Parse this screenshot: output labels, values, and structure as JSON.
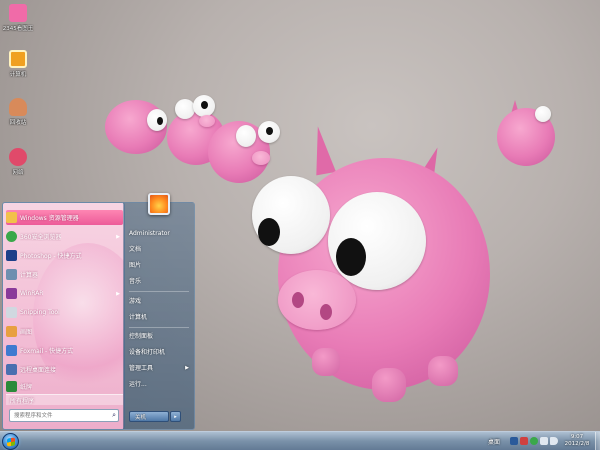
{
  "desktop": {
    "icons": [
      {
        "label": "2345看图王",
        "color": "#f06ba8"
      },
      {
        "label": "计算机",
        "color": "#f0a020"
      },
      {
        "label": "回收站",
        "color": "#d88a5a"
      },
      {
        "label": "网络",
        "color": "#e04a6a"
      }
    ]
  },
  "start_menu": {
    "programs": [
      {
        "label": "Windows 资源管理器",
        "icon": "folder-icon",
        "color": "#f2c14a",
        "has_submenu": false,
        "highlighted": true
      },
      {
        "label": "360安全浏览器",
        "icon": "browser-icon",
        "color": "#3aa84a",
        "has_submenu": true,
        "highlighted": false
      },
      {
        "label": "Photoshop - 快捷方式",
        "icon": "photoshop-icon",
        "color": "#1d3f8a",
        "has_submenu": false,
        "highlighted": false
      },
      {
        "label": "计算器",
        "icon": "calculator-icon",
        "color": "#6f8fb0",
        "has_submenu": false,
        "highlighted": false
      },
      {
        "label": "WinRAR",
        "icon": "winrar-icon",
        "color": "#8a3a9a",
        "has_submenu": true,
        "highlighted": false
      },
      {
        "label": "Snipping Tool",
        "icon": "scissors-icon",
        "color": "#d0d8e0",
        "has_submenu": false,
        "highlighted": false
      },
      {
        "label": "画图",
        "icon": "paint-icon",
        "color": "#e8a040",
        "has_submenu": false,
        "highlighted": false
      },
      {
        "label": "Foxmail - 快捷方式",
        "icon": "mail-icon",
        "color": "#3f7ad0",
        "has_submenu": false,
        "highlighted": false
      },
      {
        "label": "远程桌面连接",
        "icon": "remote-desktop-icon",
        "color": "#4a6fb0",
        "has_submenu": false,
        "highlighted": false
      },
      {
        "label": "纸牌",
        "icon": "cards-icon",
        "color": "#2a8a3a",
        "has_submenu": false,
        "highlighted": false
      }
    ],
    "all_programs_label": "所有程序",
    "search_placeholder": "搜索程序和文件",
    "right_column": {
      "user_name": "Administrator",
      "items": [
        "文档",
        "图片",
        "音乐",
        "游戏",
        "计算机",
        "控制面板",
        "设备和打印机",
        "管理工具",
        "运行..."
      ],
      "submenu_items": [
        "管理工具"
      ],
      "shutdown_label": "关机"
    }
  },
  "taskbar": {
    "tray_label": "桌面",
    "tray_icons": [
      {
        "name": "ime-icon",
        "color": "#2a5a9a"
      },
      {
        "name": "action-center-icon",
        "color": "#d04040"
      },
      {
        "name": "antivirus-icon",
        "color": "#3aa84a"
      },
      {
        "name": "network-icon",
        "color": "#e0e8f0"
      },
      {
        "name": "volume-icon",
        "color": "#e0e8f0"
      }
    ],
    "clock_time": "9:07",
    "clock_date": "2012/2/8"
  }
}
